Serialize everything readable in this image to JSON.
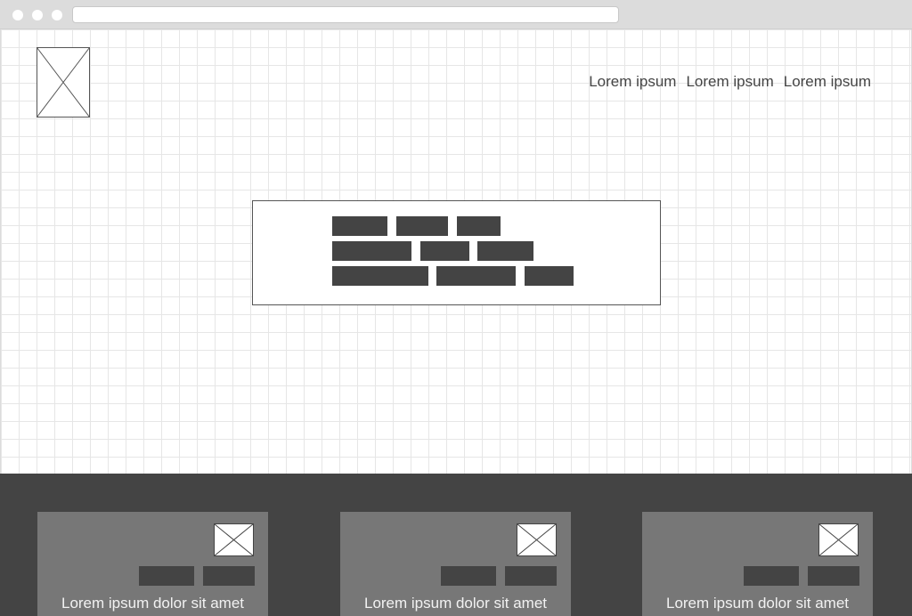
{
  "nav": {
    "items": [
      "Lorem ipsum",
      "Lorem ipsum",
      "Lorem ipsum"
    ]
  },
  "cards": [
    {
      "caption": "Lorem ipsum dolor sit amet"
    },
    {
      "caption": "Lorem ipsum dolor sit amet"
    },
    {
      "caption": "Lorem ipsum dolor sit amet"
    }
  ],
  "colors": {
    "placeholder_block": "#444444",
    "footer_bg": "#444444",
    "card_bg": "#777777",
    "grid_line": "#e6e6e6",
    "chrome_bar": "#dcdcdc"
  },
  "icons": {
    "logo": "image-placeholder-icon",
    "card_image": "image-placeholder-icon"
  }
}
